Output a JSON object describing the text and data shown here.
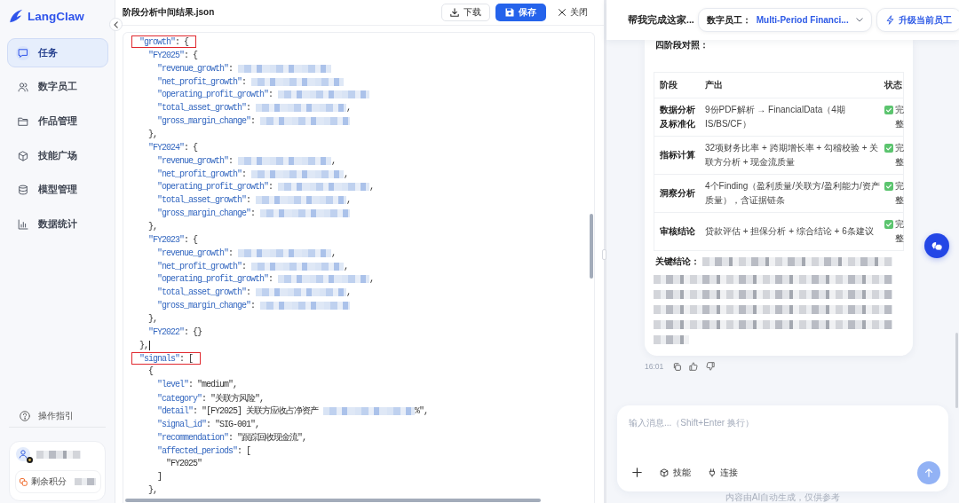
{
  "sidebar": {
    "logo": "LangClaw",
    "nav_items": [
      {
        "label": "任务",
        "selected": true
      },
      {
        "label": "数字员工",
        "selected": false
      },
      {
        "label": "作品管理",
        "selected": false
      },
      {
        "label": "技能广场",
        "selected": false
      },
      {
        "label": "模型管理",
        "selected": false
      },
      {
        "label": "数据统计",
        "selected": false
      }
    ],
    "help": "操作指引",
    "user": {
      "name_redacted": true,
      "credits_label": "剩余积分",
      "credits_redacted": true
    }
  },
  "editor": {
    "title": "阶段分析中间结果.json",
    "buttons": [
      {
        "label": "下载",
        "kind": "secondary"
      },
      {
        "label": "保存",
        "kind": "primary"
      },
      {
        "label": "关闭",
        "kind": "plain"
      }
    ],
    "lines": [
      {
        "key": "\"growth\"",
        "text": ": {",
        "highlighted": true,
        "children": [
          {
            "key": "\"FY2025\"",
            "text": ": {",
            "children": [
              {
                "key": "\"revenue_growth\"",
                "text": ":",
                "redacted": true
              },
              {
                "key": "\"net_profit_growth\"",
                "text": ":",
                "redacted": true
              },
              {
                "key": "\"operating_profit_growth\"",
                "text": ":",
                "redacted": true
              },
              {
                "key": "\"total_asset_growth\"",
                "text": ":",
                "redacted": true,
                "suffix": ","
              },
              {
                "key": "\"gross_margin_change\"",
                "text": ":",
                "redacted": true
              }
            ]
          },
          {
            "text": "},"
          },
          {
            "key": "\"FY2024\"",
            "text": ": {",
            "children": [
              {
                "key": "\"revenue_growth\"",
                "text": ":",
                "redacted": true,
                "suffix": ","
              },
              {
                "key": "\"net_profit_growth\"",
                "text": ":",
                "redacted": true,
                "suffix": ","
              },
              {
                "key": "\"operating_profit_growth\"",
                "text": ":",
                "redacted": true,
                "suffix": ","
              },
              {
                "key": "\"total_asset_growth\"",
                "text": ":",
                "redacted": true,
                "suffix": ","
              },
              {
                "key": "\"gross_margin_change\"",
                "text": ":",
                "redacted": true
              }
            ]
          },
          {
            "text": "},"
          },
          {
            "key": "\"FY2023\"",
            "text": ": {",
            "children": [
              {
                "key": "\"revenue_growth\"",
                "text": ":",
                "redacted": true,
                "suffix": ","
              },
              {
                "key": "\"net_profit_growth\"",
                "text": ":",
                "redacted": true,
                "suffix": ","
              },
              {
                "key": "\"operating_profit_growth\"",
                "text": ":",
                "redacted": true,
                "suffix": ","
              },
              {
                "key": "\"total_asset_growth\"",
                "text": ":",
                "redacted": true,
                "suffix": ","
              },
              {
                "key": "\"gross_margin_change\"",
                "text": ":",
                "redacted": true
              }
            ]
          },
          {
            "text": "},"
          },
          {
            "key": "\"FY2022\"",
            "text": ": {}"
          }
        ]
      },
      {
        "text": "},",
        "cursor": true
      },
      {
        "key": "\"signals\"",
        "text": ": [",
        "highlighted": true,
        "children": [
          {
            "text": "{",
            "children": [
              {
                "key": "\"level\"",
                "text": ": \"medium\","
              },
              {
                "key": "\"category\"",
                "text": ": \"关联方风险\","
              },
              {
                "key": "\"detail\"",
                "text": ": \"[FY2025] 关联方应收占净资产",
                "redacted": true,
                "suffix": "%\","
              },
              {
                "key": "\"signal_id\"",
                "text": ": \"SIG-001\","
              },
              {
                "key": "\"recommendation\"",
                "text": ": \"跟踪回收现金流\","
              },
              {
                "key": "\"affected_periods\"",
                "text": ": [",
                "children": [
                  {
                    "text": "\"FY2025\""
                  }
                ]
              },
              {
                "text": "]"
              }
            ]
          },
          {
            "text": "},"
          }
        ]
      }
    ]
  },
  "chat": {
    "task_title": "帮我完成这家...",
    "employee_label": "数字员工：",
    "employee_value": "Multi-Period Financi...",
    "upgrade_button": "升级当前员工",
    "message": {
      "heading": "四阶段对照：",
      "table": {
        "columns": [
          "阶段",
          "产出",
          "状态"
        ],
        "rows": [
          {
            "stage": "数据分析及标准化",
            "output": "9份PDF解析 → FinancialData（4期 IS/BS/CF）",
            "status": "完整"
          },
          {
            "stage": "指标计算",
            "output": "32项财务比率 + 跨期增长率 + 勾稽校验 + 关联方分析 + 现金流质量",
            "status": "完整"
          },
          {
            "stage": "洞察分析",
            "output": "4个Finding（盈利质量/关联方/盈利能力/资产质量），含证据链条",
            "status": "完整"
          },
          {
            "stage": "审核结论",
            "output": "贷款评估 + 担保分析 + 综合结论 + 6条建议",
            "status": "完整"
          }
        ]
      },
      "conclusion_label": "关键结论：",
      "conclusion_redacted": true,
      "time": "16:01"
    },
    "composer": {
      "placeholder": "输入消息...（Shift+Enter 换行）",
      "tools": [
        "技能",
        "连接"
      ],
      "send_disabled": true
    },
    "footer": "内容由AI自动生成，仅供参考"
  }
}
